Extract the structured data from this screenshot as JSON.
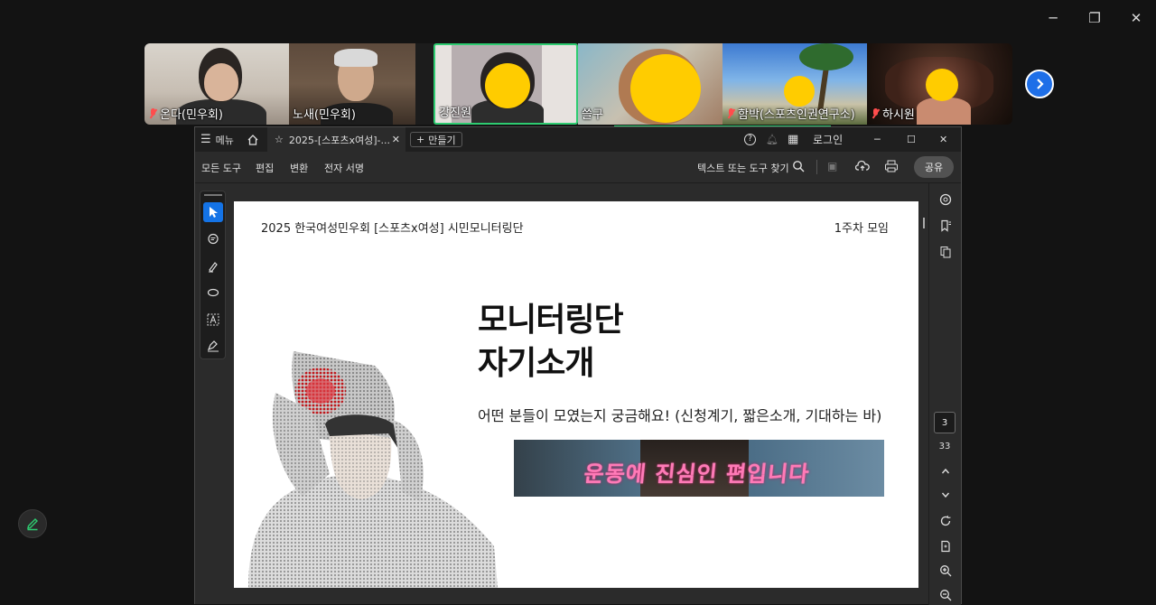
{
  "window_controls": {
    "minimize": "─",
    "restore": "❐",
    "close": "✕"
  },
  "participants": [
    {
      "name": "온다(민우회)",
      "muted": true
    },
    {
      "name": "노새(민우회)",
      "muted": false
    },
    {
      "name": "강진원",
      "muted": false,
      "active_speaker": true
    },
    {
      "name": "쓸구",
      "muted": false
    },
    {
      "name": "함박(스포츠인권연구소)",
      "muted": true
    },
    {
      "name": "하시원",
      "muted": true
    }
  ],
  "acrobat": {
    "menu_label": "메뉴",
    "tab_title": "2025-[스포츠x여성]-...",
    "create_label": "만들기",
    "login_label": "로그인",
    "toolbar": {
      "all_tools": "모든 도구",
      "edit": "편집",
      "convert": "변환",
      "e_sign": "전자 서명",
      "search_placeholder": "텍스트 또는 도구 찾기",
      "share": "공유"
    },
    "current_page": "3",
    "total_pages": "33"
  },
  "slide": {
    "header_left": "2025 한국여성민우회 [스포츠x여성] 시민모니터링단",
    "header_right": "1주차 모임",
    "title_line1": "모니터링단",
    "title_line2": "자기소개",
    "subtitle": "어떤 분들이 모였는지 궁금해요! (신청계기, 짧은소개, 기대하는 바)",
    "banner_text": "운동에 진심인 편입니다"
  },
  "colors": {
    "accent": "#1473e6",
    "active_speaker_border": "#2ecc71",
    "mute": "#ff4d4d"
  }
}
